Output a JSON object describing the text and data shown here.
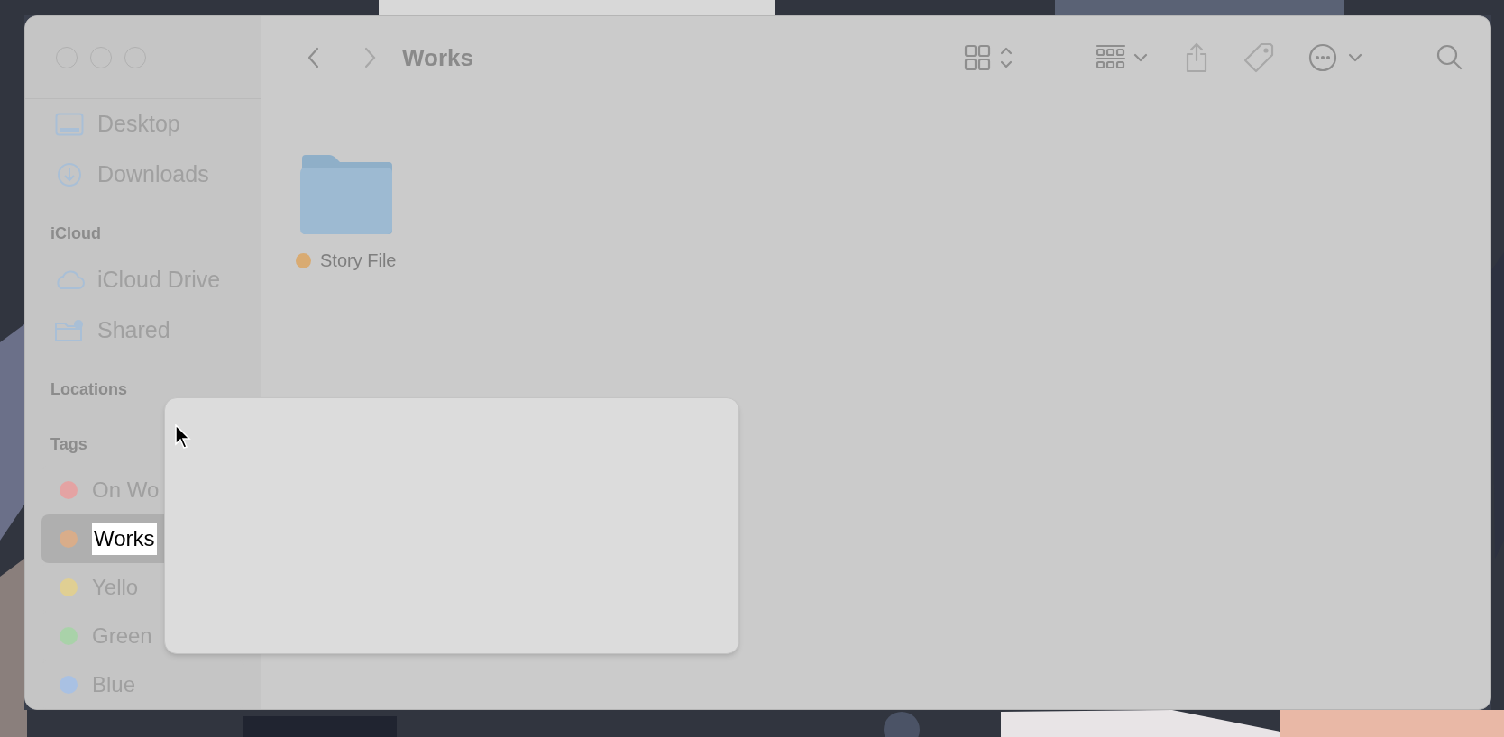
{
  "window": {
    "title": "Works"
  },
  "sidebar": {
    "sections": [
      {
        "items": [
          {
            "label": "Desktop"
          },
          {
            "label": "Downloads"
          }
        ]
      },
      {
        "title": "iCloud",
        "items": [
          {
            "label": "iCloud Drive"
          },
          {
            "label": "Shared"
          }
        ]
      },
      {
        "title": "Locations"
      },
      {
        "title": "Tags",
        "items": [
          {
            "label": "On Wo",
            "color": "#e4a3a3",
            "selected": false,
            "editing": false
          },
          {
            "label": "Works",
            "color": "#d9ad8a",
            "selected": true,
            "editing": true
          },
          {
            "label": "Yello",
            "color": "#e0cf93",
            "selected": false,
            "editing": false
          },
          {
            "label": "Green",
            "color": "#a9d2a9",
            "selected": false,
            "editing": false
          },
          {
            "label": "Blue",
            "color": "#a9c1e3",
            "selected": false,
            "editing": false
          }
        ]
      }
    ]
  },
  "content": {
    "items": [
      {
        "name": "Story File",
        "color": "#d9ab72"
      }
    ]
  }
}
